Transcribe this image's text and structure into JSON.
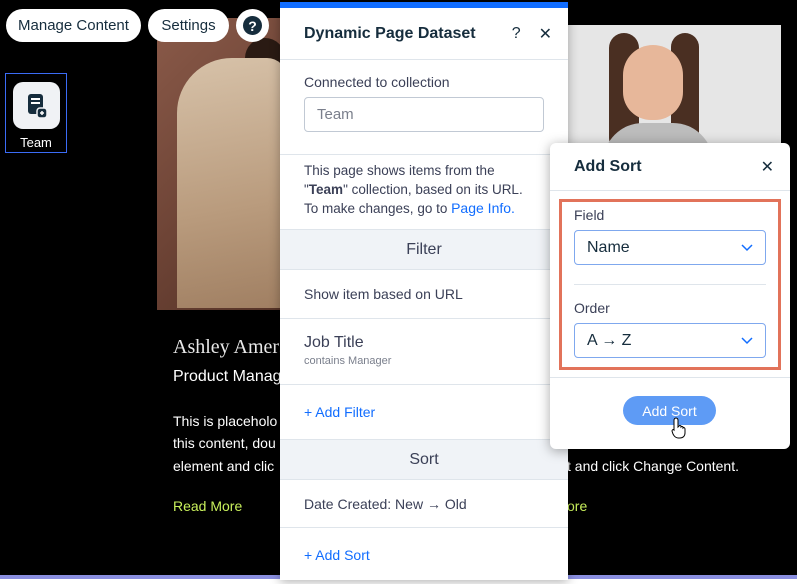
{
  "toolbar": {
    "manage_content": "Manage Content",
    "settings": "Settings",
    "help": "?"
  },
  "team_element": {
    "label": "Team",
    "icon": "dataset-page-icon"
  },
  "page_content": {
    "name": "Ashley Amers",
    "role": "Product Manag",
    "para_l1": "This is placeholo",
    "para_l2": "this content, dou",
    "para_l3": "element and clic",
    "para_r3": "t and click Change Content.",
    "read_more_1": "Read More",
    "read_more_2": "ore"
  },
  "dataset_panel": {
    "title": "Dynamic Page Dataset",
    "help": "?",
    "close": "✕",
    "connected_label": "Connected to collection",
    "collection_value": "Team",
    "info_line1": "This page shows items from the",
    "info_quote_open": "\"",
    "info_collection": "Team",
    "info_quote_close": "\" collection, based on its URL.",
    "info_line3": "To make changes, go to ",
    "info_link": "Page Info.",
    "filter_heading": "Filter",
    "filter_url": "Show item based on URL",
    "filter_field": "Job Title",
    "filter_condition": "contains Manager",
    "add_filter": "+ Add Filter",
    "sort_heading": "Sort",
    "sort_item": "Date Created: New → Old",
    "add_sort": "+ Add Sort",
    "accent_color": "#116dff"
  },
  "sort_popover": {
    "title": "Add Sort",
    "close": "✕",
    "field_label": "Field",
    "field_value": "Name",
    "order_label": "Order",
    "order_value": "A → Z",
    "button": "Add Sort",
    "highlight_color": "#e2735a"
  }
}
